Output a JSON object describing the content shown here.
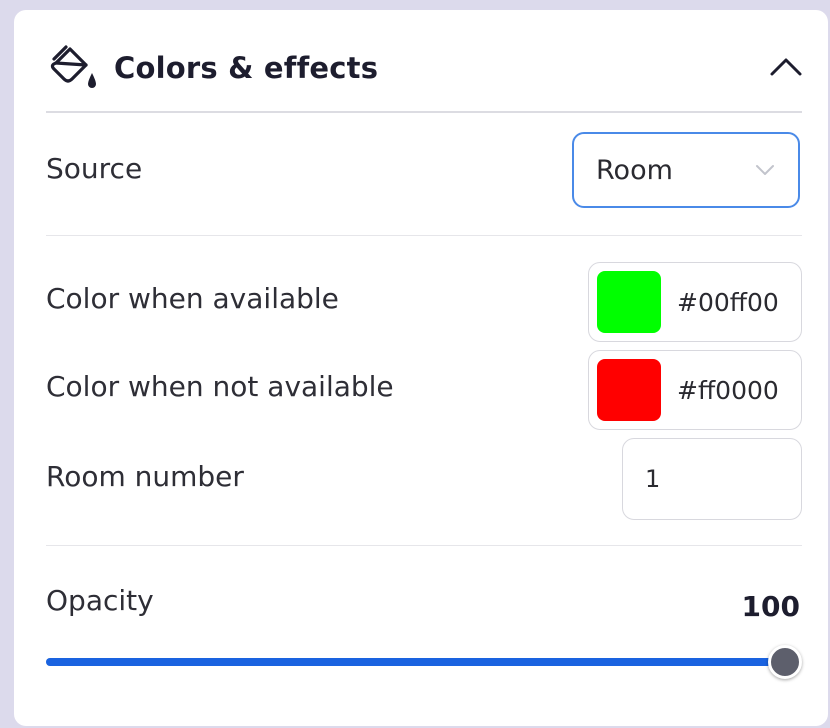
{
  "header": {
    "title": "Colors & effects",
    "icon": "paint-bucket-icon",
    "collapse_icon": "chevron-up-icon"
  },
  "source": {
    "label": "Source",
    "value": "Room"
  },
  "available": {
    "label": "Color when available",
    "color": "#00ff00",
    "hex": "#00ff00"
  },
  "not_available": {
    "label": "Color when not available",
    "color": "#ff0000",
    "hex": "#ff0000"
  },
  "room_number": {
    "label": "Room number",
    "value": "1"
  },
  "opacity": {
    "label": "Opacity",
    "value": "100",
    "fraction": 1.0
  },
  "colors": {
    "accent": "#1a63e0",
    "select_border": "#4a8ae8"
  }
}
